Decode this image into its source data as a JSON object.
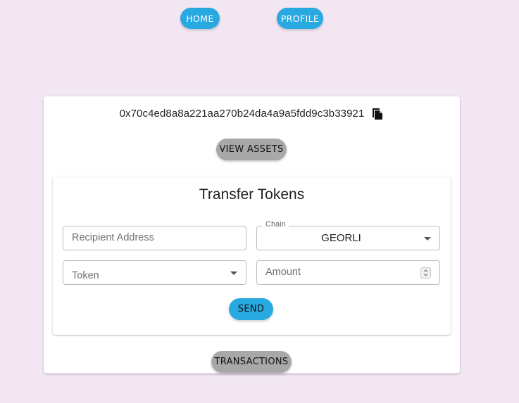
{
  "nav": {
    "home_label": "HOME",
    "profile_label": "PROFILE"
  },
  "wallet": {
    "address": "0x70c4ed8a8a221aa270b24da4a9a5fdd9c3b33921",
    "copy_icon": "copy-icon",
    "view_assets_label": "VIEW ASSETS",
    "transactions_label": "TRANSACTIONS"
  },
  "transfer": {
    "title": "Transfer Tokens",
    "recipient_placeholder": "Recipient Address",
    "chain_label": "Chain",
    "chain_value": "GEORLI",
    "token_placeholder": "Token",
    "amount_placeholder": "Amount",
    "send_label": "SEND"
  },
  "colors": {
    "background": "#f1e6f2",
    "primary_button": "#29a9e1",
    "secondary_button": "#a8a8a8",
    "card": "#ffffff"
  }
}
